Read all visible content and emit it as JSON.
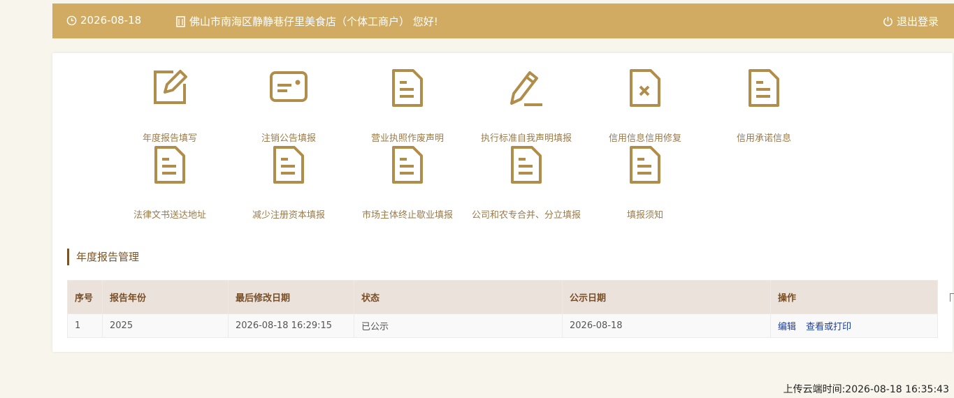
{
  "header": {
    "date": "2026-08-18",
    "company": "佛山市南海区静静巷仔里美食店（个体工商户） 您好!",
    "logout": "退出登录"
  },
  "tiles": [
    {
      "label": "年度报告填写",
      "icon": "edit-icon"
    },
    {
      "label": "注销公告填报",
      "icon": "id-card-icon"
    },
    {
      "label": "营业执照作废声明",
      "icon": "document-icon"
    },
    {
      "label": "执行标准自我声明填报",
      "icon": "pen-icon"
    },
    {
      "label": "信用信息信用修复",
      "icon": "document-x-icon"
    },
    {
      "label": "信用承诺信息",
      "icon": "document-icon"
    },
    {
      "label": "法律文书送达地址",
      "icon": "document-icon"
    },
    {
      "label": "减少注册资本填报",
      "icon": "document-icon"
    },
    {
      "label": "市场主体终止歇业填报",
      "icon": "document-icon"
    },
    {
      "label": "公司和农专合并、分立填报",
      "icon": "document-icon"
    },
    {
      "label": "填报须知",
      "icon": "document-icon"
    }
  ],
  "section": {
    "title": "年度报告管理"
  },
  "table": {
    "headers": [
      "序号",
      "报告年份",
      "最后修改日期",
      "状态",
      "公示日期",
      "操作"
    ],
    "rows": [
      {
        "index": "1",
        "year": "2025",
        "modified": "2026-08-18 16:29:15",
        "status": "已公示",
        "publish_date": "2026-08-18",
        "edit": "编辑",
        "view": "查看或打印"
      }
    ]
  },
  "footer": {
    "upload_time": "上传云端时间:2026-08-18 16:35:43"
  },
  "colors": {
    "header_bg": "#d1ab62",
    "icon": "#b08d4b",
    "label": "#9a7a4a",
    "table_head": "#ebe2dc"
  }
}
